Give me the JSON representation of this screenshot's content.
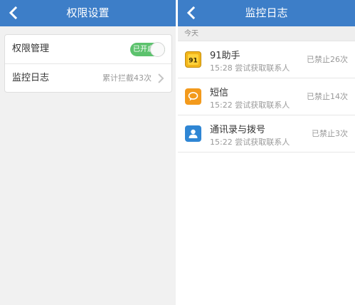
{
  "left_screen": {
    "titlebar": {
      "title": "权限设置",
      "back_icon": "chevron-left-icon"
    },
    "settings": {
      "permission_management": {
        "label": "权限管理",
        "toggle_text": "已开启",
        "toggle_on": true
      },
      "monitor_log": {
        "label": "监控日志",
        "value": "累计拦截43次",
        "chevron_icon": "chevron-right-icon"
      }
    }
  },
  "right_screen": {
    "titlebar": {
      "title": "监控日志",
      "back_icon": "chevron-left-icon"
    },
    "section_header": "今天",
    "log_items": [
      {
        "name": "91助手",
        "subtitle": "15:28 尝试获取联系人",
        "status": "已禁止26次",
        "icon": "91-assistant-icon"
      },
      {
        "name": "短信",
        "subtitle": "15:22 尝试获取联系人",
        "status": "已禁止14次",
        "icon": "sms-icon"
      },
      {
        "name": "通讯录与拨号",
        "subtitle": "15:22 尝试获取联系人",
        "status": "已禁止3次",
        "icon": "contacts-icon"
      }
    ]
  },
  "colors": {
    "titlebar": "#3d7ec8",
    "toggle_on": "#5cc26d",
    "background": "#f1f1f1",
    "secondary_text": "#999999"
  }
}
